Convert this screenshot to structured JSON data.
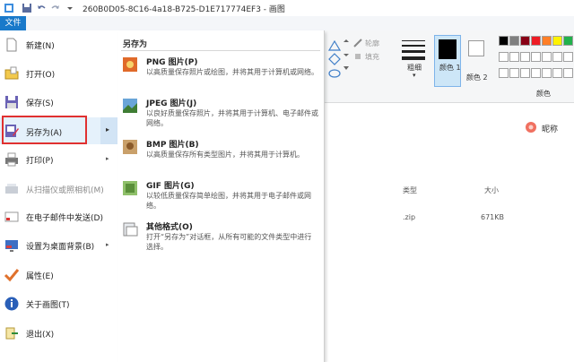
{
  "titlebar": {
    "title": "260B0D05-8C16-4a18-B725-D1E717774EF3 - 画图"
  },
  "file_tab": {
    "label": "文件"
  },
  "file_menu": {
    "items": [
      {
        "label": "新建(N)",
        "has_arrow": false,
        "disabled": false
      },
      {
        "label": "打开(O)",
        "has_arrow": false,
        "disabled": false
      },
      {
        "label": "保存(S)",
        "has_arrow": false,
        "disabled": false
      },
      {
        "label": "另存为(A)",
        "has_arrow": true,
        "disabled": false
      },
      {
        "label": "打印(P)",
        "has_arrow": true,
        "disabled": false
      },
      {
        "label": "从扫描仪或照相机(M)",
        "has_arrow": false,
        "disabled": true
      },
      {
        "label": "在电子邮件中发送(D)",
        "has_arrow": false,
        "disabled": false
      },
      {
        "label": "设置为桌面背景(B)",
        "has_arrow": true,
        "disabled": false
      },
      {
        "label": "属性(E)",
        "has_arrow": false,
        "disabled": false
      },
      {
        "label": "关于画图(T)",
        "has_arrow": false,
        "disabled": false
      },
      {
        "label": "退出(X)",
        "has_arrow": false,
        "disabled": false
      }
    ]
  },
  "saveas": {
    "title": "另存为",
    "items": [
      {
        "title": "PNG 图片(P)",
        "desc": "以高质量保存照片或绘图，并将其用于计算机或网络。"
      },
      {
        "title": "JPEG 图片(J)",
        "desc": "以良好质量保存照片，并将其用于计算机、电子邮件或网络。"
      },
      {
        "title": "BMP 图片(B)",
        "desc": "以高质量保存所有类型图片，并将其用于计算机。"
      },
      {
        "title": "GIF 图片(G)",
        "desc": "以较低质量保存简单绘图，并将其用于电子邮件或网络。"
      },
      {
        "title": "其他格式(O)",
        "desc": "打开“另存为”对话框，从所有可能的文件类型中进行选择。"
      }
    ]
  },
  "ribbon": {
    "outline": "轮廓",
    "fill": "填充",
    "size": "粗细",
    "color1": "颜色 1",
    "color2": "颜色 2",
    "colors_group": "颜色",
    "palette": [
      "#000000",
      "#7f7f7f",
      "#880015",
      "#ed1c24",
      "#ff7f27",
      "#fff200",
      "#22b14c",
      "#00a2e8",
      "#3f48cc",
      "#a349a4"
    ]
  },
  "background": {
    "nickname": "昵称",
    "type_header": "类型",
    "size_header": "大小",
    "file_type": ".zip",
    "file_size": "671KB"
  }
}
